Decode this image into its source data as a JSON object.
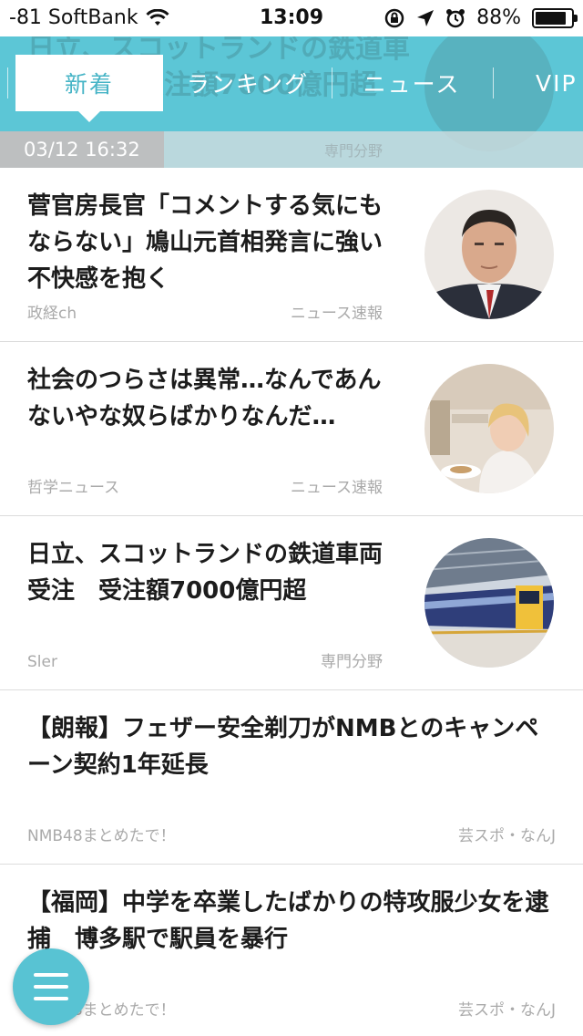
{
  "status_bar": {
    "carrier": "-81 SoftBank",
    "time": "13:09",
    "battery_percent": "88%",
    "battery_level": 0.88,
    "icons": [
      "wifi-icon",
      "lock-rotation-icon",
      "location-icon",
      "alarm-icon",
      "battery-icon"
    ]
  },
  "header": {
    "accent_color": "#5cc6d6",
    "ghost_title": "日立、スコットランドの鉄道車両受注　受注額7000億円超",
    "ghost_category": "専門分野",
    "tabs": [
      {
        "label": "新着",
        "active": true
      },
      {
        "label": "ランキング",
        "active": false
      },
      {
        "label": "ニュース",
        "active": false
      },
      {
        "label": "VIP",
        "active": false
      }
    ],
    "date": "03/12 16:32"
  },
  "articles": [
    {
      "title": "菅官房長官「コメントする気にもならない」鳩山元首相発言に強い不快感を抱く",
      "source": "政経ch",
      "category": "ニュース速報",
      "thumb": "politician-portrait"
    },
    {
      "title": "社会のつらさは異常…なんであんないやな奴らばかりなんだ…",
      "source": "哲学ニュース",
      "category": "ニュース速報",
      "thumb": "cafe-woman"
    },
    {
      "title": "日立、スコットランドの鉄道車両受注　受注額7000億円超",
      "source": "Sler",
      "category": "専門分野",
      "thumb": "train-station"
    },
    {
      "title": "【朗報】フェザー安全剃刀がNMBとのキャンペーン契約1年延長",
      "source": "NMB48まとめたで！",
      "category": "芸スポ・なんJ",
      "thumb": ""
    },
    {
      "title": "【福岡】中学を卒業したばかりの特攻服少女を逮捕　博多駅で駅員を暴行",
      "source": "NMB48まとめたで！",
      "category": "芸スポ・なんJ",
      "thumb": ""
    }
  ],
  "menu_button": {
    "icon": "hamburger-menu-icon"
  }
}
